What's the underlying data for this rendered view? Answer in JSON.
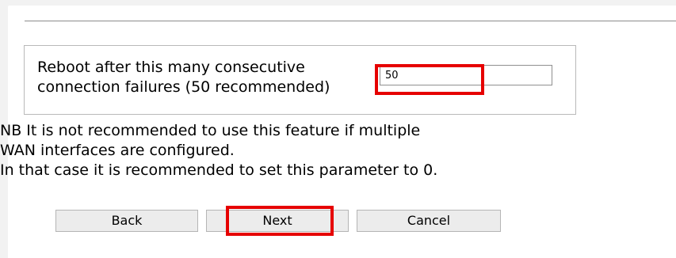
{
  "setting": {
    "label": "Reboot after this many consecutive\nconnection failures (50 recommended)",
    "value": "50"
  },
  "note": {
    "lines": [
      "NB It is not recommended to use this feature if multiple",
      "WAN interfaces are configured.",
      "In that case it is recommended to set this parameter to 0."
    ]
  },
  "buttons": {
    "back": "Back",
    "next": "Next",
    "cancel": "Cancel"
  },
  "highlight_color": "#e60000"
}
